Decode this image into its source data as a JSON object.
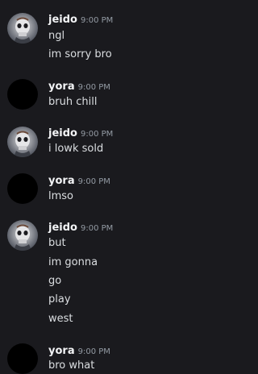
{
  "messages": [
    {
      "author": "jeido",
      "time": "9:00 PM",
      "avatar_icon": "skull-avatar-icon",
      "lines": [
        "ngl",
        "im sorry bro"
      ]
    },
    {
      "author": "yora",
      "time": "9:00 PM",
      "avatar_icon": "black-avatar-icon",
      "lines": [
        "bruh chill"
      ]
    },
    {
      "author": "jeido",
      "time": "9:00 PM",
      "avatar_icon": "skull-avatar-icon",
      "lines": [
        "i lowk sold"
      ]
    },
    {
      "author": "yora",
      "time": "9:00 PM",
      "avatar_icon": "black-avatar-icon",
      "lines": [
        "lmso"
      ]
    },
    {
      "author": "jeido",
      "time": "9:00 PM",
      "avatar_icon": "skull-avatar-icon",
      "lines": [
        "but",
        "im gonna",
        "go",
        "play",
        "west"
      ]
    },
    {
      "author": "yora",
      "time": "9:00 PM",
      "avatar_icon": "black-avatar-icon",
      "lines": [
        "bro what"
      ]
    }
  ],
  "colors": {
    "background": "#1a1a1e",
    "username": "#f2f3f5",
    "timestamp": "#949ba4",
    "message_text": "#dbdee1"
  }
}
